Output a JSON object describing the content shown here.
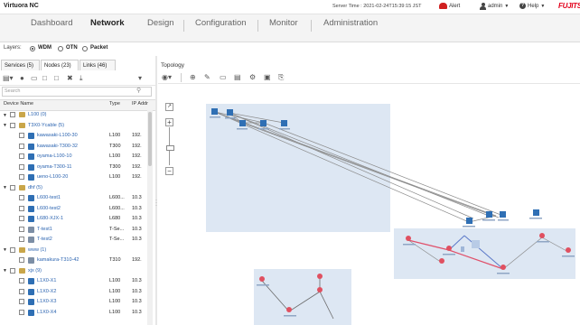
{
  "header": {
    "app_title": "Virtuora NC",
    "server_time": "Server Time : 2021-02-24T15:39:15 JST",
    "alert": "Alert",
    "user": "admin",
    "help": "Help",
    "brand": "FUJITSU"
  },
  "nav": {
    "items": [
      "Dashboard",
      "Network",
      "Design",
      "Configuration",
      "Monitor",
      "Administration"
    ],
    "active": "Network"
  },
  "layers": {
    "label": "Layers:",
    "options": [
      "WDM",
      "OTN",
      "Packet"
    ],
    "selected": "WDM"
  },
  "left_tabs": [
    "Services (5)",
    "Nodes (23)",
    "Links (46)"
  ],
  "search": {
    "placeholder": "Search"
  },
  "columns": [
    "Device Name",
    "Type",
    "IP Addr"
  ],
  "tree": [
    {
      "level": 0,
      "kind": "group",
      "name": "L100 (0)",
      "type": "",
      "ip": ""
    },
    {
      "level": 0,
      "kind": "group",
      "name": "T3X0-Ycable (5)",
      "type": "",
      "ip": ""
    },
    {
      "level": 1,
      "kind": "node",
      "name": "kawasaki-L100-30",
      "type": "L100",
      "ip": "192."
    },
    {
      "level": 1,
      "kind": "node",
      "name": "kawasaki-T300-32",
      "type": "T300",
      "ip": "192."
    },
    {
      "level": 1,
      "kind": "node",
      "name": "oyama-L100-10",
      "type": "L100",
      "ip": "192."
    },
    {
      "level": 1,
      "kind": "node",
      "name": "oyama-T300-11",
      "type": "T300",
      "ip": "192."
    },
    {
      "level": 1,
      "kind": "node",
      "name": "ueno-L100-20",
      "type": "L100",
      "ip": "192."
    },
    {
      "level": 0,
      "kind": "group",
      "name": "dhf (5)",
      "type": "",
      "ip": ""
    },
    {
      "level": 1,
      "kind": "node",
      "name": "L600-test1",
      "type": "L600...",
      "ip": "10.3"
    },
    {
      "level": 1,
      "kind": "node",
      "name": "L600-test2",
      "type": "L600...",
      "ip": "10.3"
    },
    {
      "level": 1,
      "kind": "node",
      "name": "L680-XJX-1",
      "type": "L680",
      "ip": "10.3"
    },
    {
      "level": 1,
      "kind": "node-grey",
      "name": "T-test1",
      "type": "T-Se...",
      "ip": "10.3"
    },
    {
      "level": 1,
      "kind": "node-grey",
      "name": "T-test2",
      "type": "T-Se...",
      "ip": "10.3"
    },
    {
      "level": 0,
      "kind": "group",
      "name": "www (1)",
      "type": "",
      "ip": ""
    },
    {
      "level": 1,
      "kind": "node-grey",
      "name": "kamakura-T310-42",
      "type": "T310",
      "ip": "192."
    },
    {
      "level": 0,
      "kind": "group",
      "name": "xjx (9)",
      "type": "",
      "ip": ""
    },
    {
      "level": 1,
      "kind": "node",
      "name": "L1X0-X1",
      "type": "L100",
      "ip": "10.3"
    },
    {
      "level": 1,
      "kind": "node",
      "name": "L1X0-X2",
      "type": "L100",
      "ip": "10.3"
    },
    {
      "level": 1,
      "kind": "node",
      "name": "L1X0-X3",
      "type": "L100",
      "ip": "10.3"
    },
    {
      "level": 1,
      "kind": "node",
      "name": "L1X0-X4",
      "type": "L100",
      "ip": "10.3"
    }
  ],
  "topology": {
    "title": "Topology"
  }
}
